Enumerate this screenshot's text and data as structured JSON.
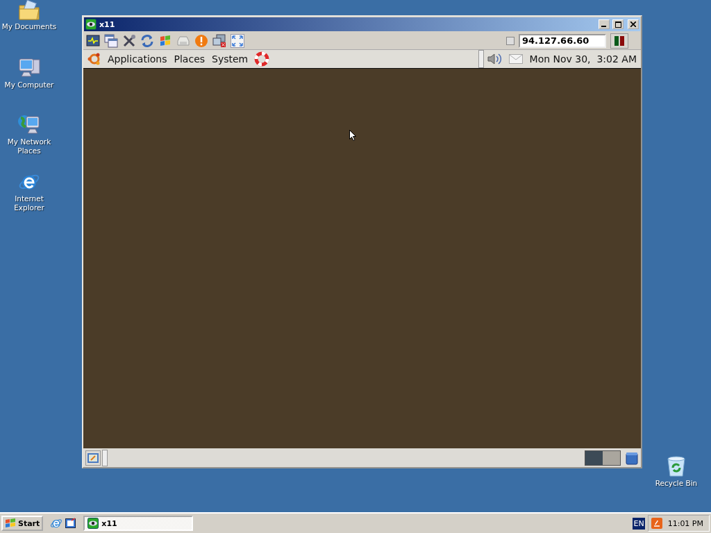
{
  "desktop_icons": [
    {
      "kind": "documents",
      "label": "My Documents"
    },
    {
      "kind": "computer",
      "label": "My Computer"
    },
    {
      "kind": "network",
      "label": "My Network Places"
    },
    {
      "kind": "browser",
      "label": "Internet Explorer"
    },
    {
      "kind": "trash",
      "label": "Recycle Bin"
    }
  ],
  "window": {
    "title": "x11",
    "address": "94.127.66.60",
    "panel_menus": [
      "Applications",
      "Places",
      "System"
    ],
    "clock": "Mon Nov 30,  3:02 AM",
    "workspaces": [
      {
        "selected": true
      },
      {
        "selected": false
      }
    ]
  },
  "taskbar": {
    "start": "Start",
    "tasks": [
      {
        "label": "x11",
        "selected": true
      }
    ],
    "language": "EN",
    "clock": "11:01 PM"
  }
}
